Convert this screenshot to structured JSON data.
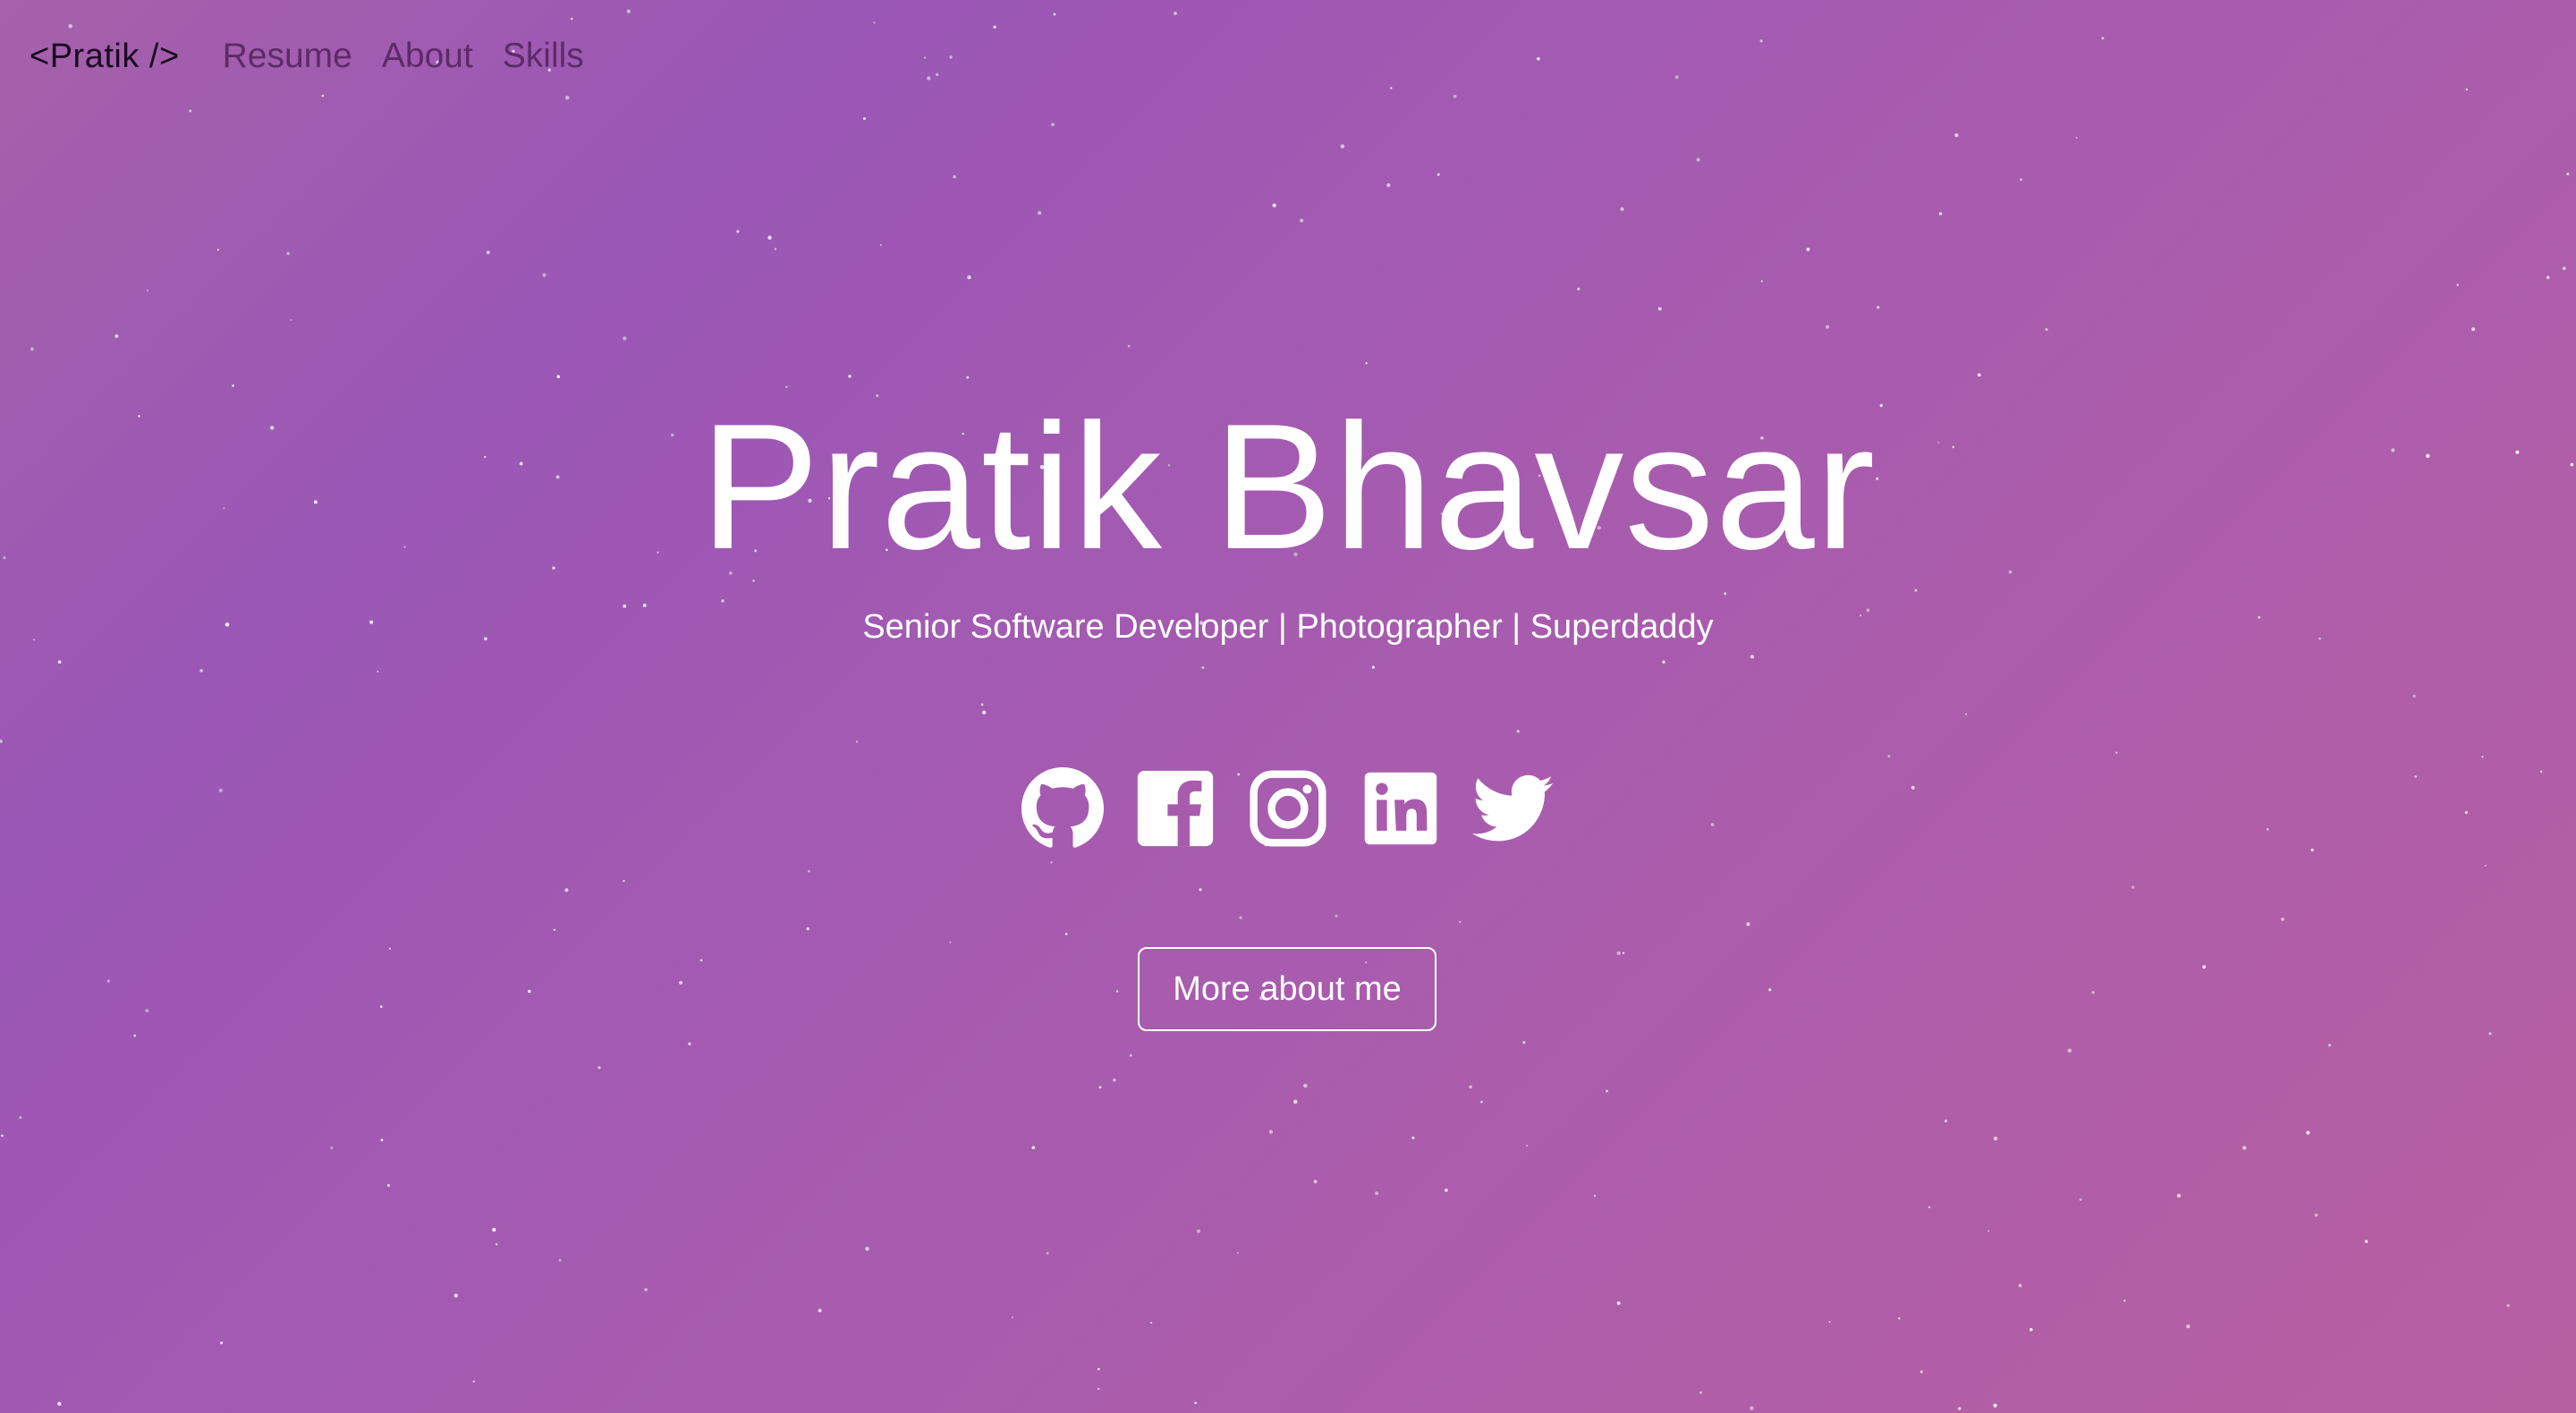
{
  "nav": {
    "brand": "<Pratik />",
    "links": [
      "Resume",
      "About",
      "Skills"
    ]
  },
  "hero": {
    "name": "Pratik Bhavsar",
    "tagline": "Senior Software Developer | Photographer | Superdaddy",
    "cta_label": "More about me"
  },
  "socials": [
    {
      "name": "github",
      "icon": "github-icon"
    },
    {
      "name": "facebook",
      "icon": "facebook-icon"
    },
    {
      "name": "instagram",
      "icon": "instagram-icon"
    },
    {
      "name": "linkedin",
      "icon": "linkedin-icon"
    },
    {
      "name": "twitter",
      "icon": "twitter-icon"
    }
  ],
  "colors": {
    "gradient_start": "#a561a9",
    "gradient_mid": "#9b57b6",
    "gradient_end": "#b760a2",
    "brand_text": "#1a0a22",
    "nav_link": "#5e2a6a",
    "foreground": "#ffffff"
  }
}
